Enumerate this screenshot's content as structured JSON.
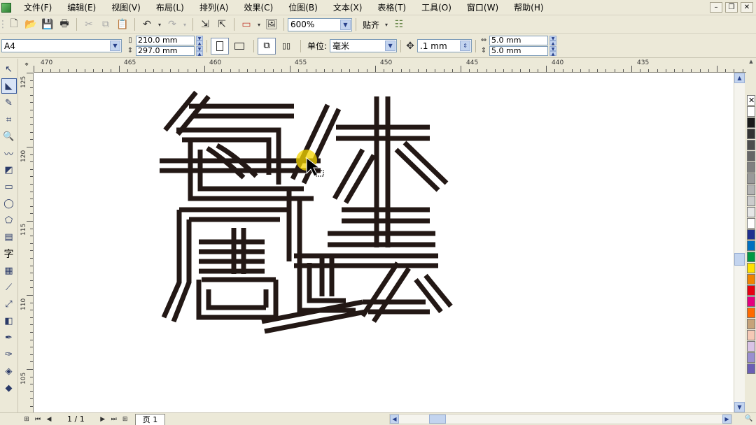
{
  "menu": {
    "items": [
      "文件(F)",
      "编辑(E)",
      "视图(V)",
      "布局(L)",
      "排列(A)",
      "效果(C)",
      "位图(B)",
      "文本(X)",
      "表格(T)",
      "工具(O)",
      "窗口(W)",
      "帮助(H)"
    ]
  },
  "toolbar": {
    "zoom": "600%",
    "snap_label": "贴齐"
  },
  "property_bar": {
    "page_size": "A4",
    "width": "210.0 mm",
    "height": "297.0 mm",
    "unit_label": "单位:",
    "unit_value": "毫米",
    "nudge": ".1 mm",
    "dup_x": "5.0 mm",
    "dup_y": "5.0 mm"
  },
  "rulers": {
    "horizontal": [
      "470",
      "465",
      "460",
      "455",
      "450",
      "445",
      "440",
      "435"
    ],
    "vertical": [
      "125",
      "120",
      "115",
      "110",
      "105"
    ]
  },
  "status": {
    "page_counter": "1 / 1",
    "page_tab": "页 1"
  },
  "palette": {
    "colors": [
      "#ffffff",
      "#1a1a1a",
      "#333333",
      "#4d4d4d",
      "#666666",
      "#808080",
      "#999999",
      "#b3b3b3",
      "#cccccc",
      "#e6e6e6",
      "#ffffff",
      "#1f2f8f",
      "#0070c0",
      "#009944",
      "#ffe100",
      "#f08300",
      "#e60012",
      "#e4007f",
      "#ff6a00",
      "#c7a37a",
      "#f6c9b6",
      "#d9c3e6",
      "#9a8fd0",
      "#6b5fb5"
    ]
  },
  "artwork": {
    "stroke_color": "#231815",
    "accent_color": "#f4d400"
  }
}
